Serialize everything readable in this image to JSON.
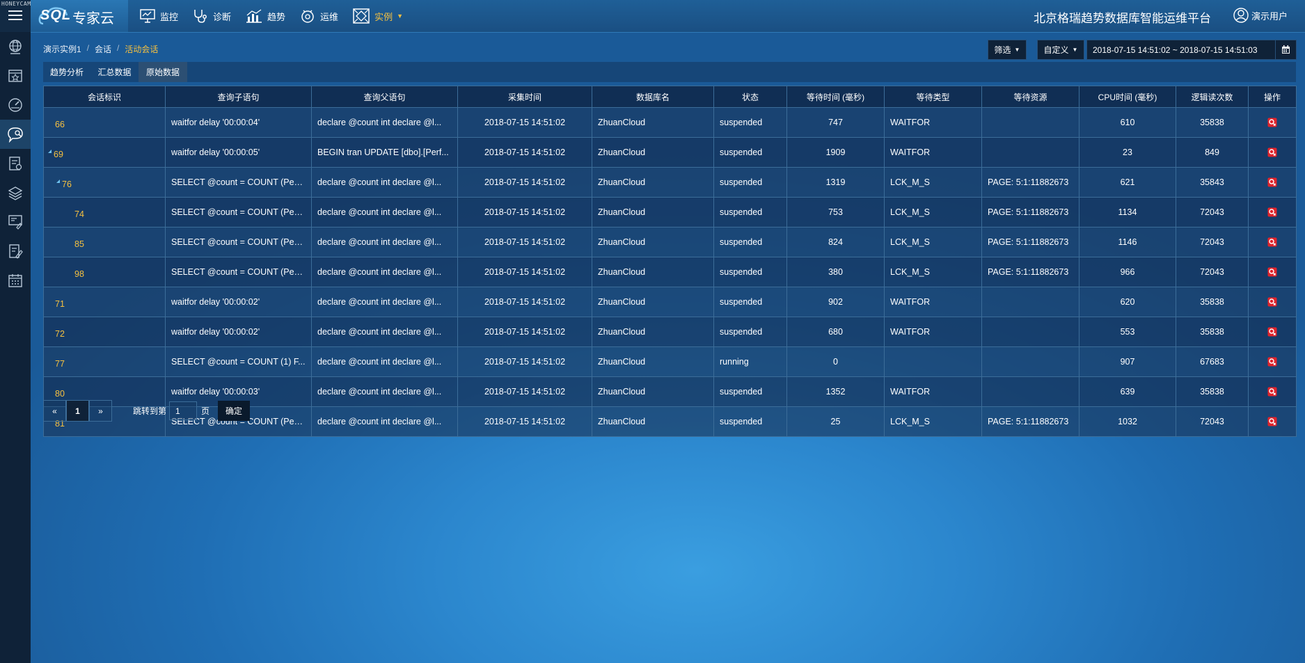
{
  "watermark": "HONEYCAM",
  "brand": {
    "logo": "SQL",
    "name": "专家云"
  },
  "nav": [
    {
      "label": "监控",
      "icon": "monitor-icon"
    },
    {
      "label": "诊断",
      "icon": "stethoscope-icon"
    },
    {
      "label": "趋势",
      "icon": "trend-chart-icon"
    },
    {
      "label": "运维",
      "icon": "ops-gauge-icon"
    },
    {
      "label": "实例",
      "icon": "instance-grid-icon",
      "active": true
    }
  ],
  "platform_title": "北京格瑞趋势数据库智能运维平台",
  "user": {
    "label": "演示用户"
  },
  "sidebar": [
    {
      "icon": "globe-icon"
    },
    {
      "icon": "star-screen-icon"
    },
    {
      "icon": "dashboard-gauge-icon"
    },
    {
      "icon": "session-chat-icon",
      "active": true
    },
    {
      "icon": "report-icon"
    },
    {
      "icon": "layers-icon"
    },
    {
      "icon": "monitor-edit-icon"
    },
    {
      "icon": "document-edit-icon"
    },
    {
      "icon": "calendar-icon"
    }
  ],
  "breadcrumb": [
    "演示实例1",
    "会话",
    "活动会话"
  ],
  "toolbar": {
    "filter_label": "筛选",
    "custom_label": "自定义",
    "date_range": "2018-07-15 14:51:02 ~ 2018-07-15 14:51:03"
  },
  "tabs": [
    {
      "label": "趋势分析"
    },
    {
      "label": "汇总数据"
    },
    {
      "label": "原始数据",
      "active": true
    }
  ],
  "table": {
    "columns": [
      "会话标识",
      "查询子语句",
      "查询父语句",
      "采集时间",
      "数据库名",
      "状态",
      "等待时间 (毫秒)",
      "等待类型",
      "等待资源",
      "CPU时间 (毫秒)",
      "逻辑读次数",
      "操作"
    ],
    "rows": [
      {
        "id": "66",
        "level": 0,
        "expander": false,
        "child": "waitfor delay '00:00:04'",
        "parent": "declare @count int declare @l...",
        "time": "2018-07-15 14:51:02",
        "db": "ZhuanCloud",
        "status": "suspended",
        "wait_ms": "747",
        "wait_type": "WAITFOR",
        "wait_res": "",
        "cpu": "610",
        "reads": "35838"
      },
      {
        "id": "69",
        "level": 0,
        "expander": true,
        "child": "waitfor delay '00:00:05'",
        "parent": "BEGIN tran UPDATE [dbo].[Perf...",
        "time": "2018-07-15 14:51:02",
        "db": "ZhuanCloud",
        "status": "suspended",
        "wait_ms": "1909",
        "wait_type": "WAITFOR",
        "wait_res": "",
        "cpu": "23",
        "reads": "849"
      },
      {
        "id": "76",
        "level": 1,
        "expander": true,
        "child": "SELECT @count = COUNT (Perf...",
        "parent": "declare @count int declare @l...",
        "time": "2018-07-15 14:51:02",
        "db": "ZhuanCloud",
        "status": "suspended",
        "wait_ms": "1319",
        "wait_type": "LCK_M_S",
        "wait_res": "PAGE: 5:1:11882673",
        "cpu": "621",
        "reads": "35843"
      },
      {
        "id": "74",
        "level": 2,
        "expander": false,
        "child": "SELECT @count = COUNT (Perf...",
        "parent": "declare @count int declare @l...",
        "time": "2018-07-15 14:51:02",
        "db": "ZhuanCloud",
        "status": "suspended",
        "wait_ms": "753",
        "wait_type": "LCK_M_S",
        "wait_res": "PAGE: 5:1:11882673",
        "cpu": "1134",
        "reads": "72043"
      },
      {
        "id": "85",
        "level": 2,
        "expander": false,
        "child": "SELECT @count = COUNT (Perf...",
        "parent": "declare @count int declare @l...",
        "time": "2018-07-15 14:51:02",
        "db": "ZhuanCloud",
        "status": "suspended",
        "wait_ms": "824",
        "wait_type": "LCK_M_S",
        "wait_res": "PAGE: 5:1:11882673",
        "cpu": "1146",
        "reads": "72043"
      },
      {
        "id": "98",
        "level": 2,
        "expander": false,
        "child": "SELECT @count = COUNT (Perf...",
        "parent": "declare @count int declare @l...",
        "time": "2018-07-15 14:51:02",
        "db": "ZhuanCloud",
        "status": "suspended",
        "wait_ms": "380",
        "wait_type": "LCK_M_S",
        "wait_res": "PAGE: 5:1:11882673",
        "cpu": "966",
        "reads": "72043"
      },
      {
        "id": "71",
        "level": 0,
        "expander": false,
        "child": "waitfor delay '00:00:02'",
        "parent": "declare @count int declare @l...",
        "time": "2018-07-15 14:51:02",
        "db": "ZhuanCloud",
        "status": "suspended",
        "wait_ms": "902",
        "wait_type": "WAITFOR",
        "wait_res": "",
        "cpu": "620",
        "reads": "35838"
      },
      {
        "id": "72",
        "level": 0,
        "expander": false,
        "child": "waitfor delay '00:00:02'",
        "parent": "declare @count int declare @l...",
        "time": "2018-07-15 14:51:02",
        "db": "ZhuanCloud",
        "status": "suspended",
        "wait_ms": "680",
        "wait_type": "WAITFOR",
        "wait_res": "",
        "cpu": "553",
        "reads": "35838"
      },
      {
        "id": "77",
        "level": 0,
        "expander": false,
        "child": "SELECT @count = COUNT (1) F...",
        "parent": "declare @count int declare @l...",
        "time": "2018-07-15 14:51:02",
        "db": "ZhuanCloud",
        "status": "running",
        "wait_ms": "0",
        "wait_type": "",
        "wait_res": "",
        "cpu": "907",
        "reads": "67683"
      },
      {
        "id": "80",
        "level": 0,
        "expander": false,
        "child": "waitfor delay '00:00:03'",
        "parent": "declare @count int declare @l...",
        "time": "2018-07-15 14:51:02",
        "db": "ZhuanCloud",
        "status": "suspended",
        "wait_ms": "1352",
        "wait_type": "WAITFOR",
        "wait_res": "",
        "cpu": "639",
        "reads": "35838"
      },
      {
        "id": "81",
        "level": 0,
        "expander": false,
        "child": "SELECT @count = COUNT (Perf...",
        "parent": "declare @count int declare @l...",
        "time": "2018-07-15 14:51:02",
        "db": "ZhuanCloud",
        "status": "suspended",
        "wait_ms": "25",
        "wait_type": "LCK_M_S",
        "wait_res": "PAGE: 5:1:11882673",
        "cpu": "1032",
        "reads": "72043"
      }
    ],
    "action_icon": "kill-session-icon"
  },
  "pagination": {
    "prev": "«",
    "current": "1",
    "next": "»",
    "jump_label": "跳转到第",
    "jump_value": "1",
    "page_suffix": "页",
    "confirm_label": "确定"
  },
  "colors": {
    "accent": "#f5c040",
    "topbar": "#1a4f82",
    "sidebar": "#0f2238",
    "action_red": "#e0242c"
  }
}
